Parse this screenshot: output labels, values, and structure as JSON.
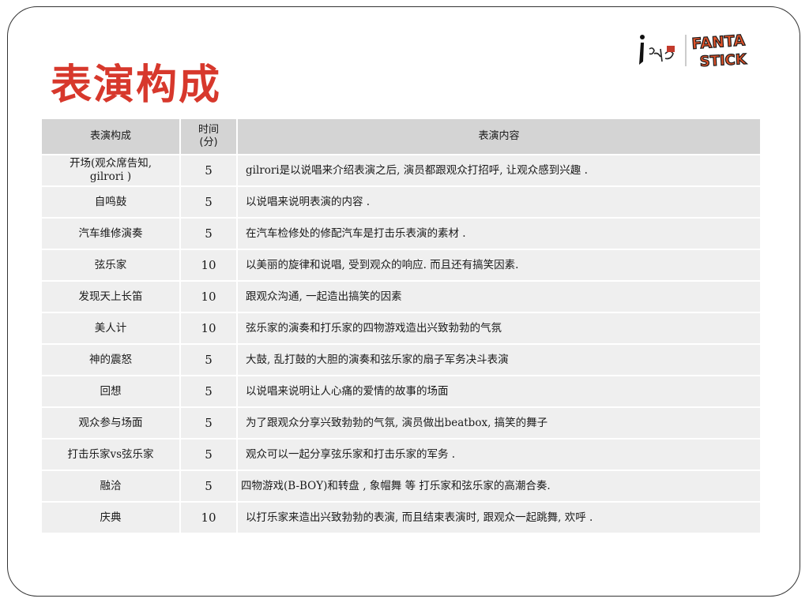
{
  "title": "表演构成",
  "logo": {
    "left_text": "i唱",
    "brand_line1": "FANTA",
    "brand_line2": "STICK",
    "brand_color": "#e0532a"
  },
  "colors": {
    "title": "#d7382c",
    "header_bg": "#d4d4d4",
    "row_bg": "#efefef"
  },
  "table": {
    "headers": {
      "name": "表演构成",
      "time_line1": "时间",
      "time_line2": "(分)",
      "desc": "表演内容"
    },
    "rows": [
      {
        "name": "开场(观众席告知,",
        "name2": "gilrori )",
        "time": "5",
        "desc": "gilrori是以说唱来介绍表演之后, 演员都跟观众打招呼, 让观众感到兴趣 ."
      },
      {
        "name": "自鸣鼓",
        "name2": "",
        "time": "5",
        "desc": "以说唱来说明表演的内容 ."
      },
      {
        "name": "汽车维修演奏",
        "name2": "",
        "time": "5",
        "desc": "在汽车检修处的修配汽车是打击乐表演的素材 ."
      },
      {
        "name": "弦乐家",
        "name2": "",
        "time": "10",
        "desc": "以美丽的旋律和说唱, 受到观众的响应. 而且还有搞笑因素."
      },
      {
        "name": "发现天上长笛",
        "name2": "",
        "time": "10",
        "desc": "跟观众沟通, 一起造出搞笑的因素"
      },
      {
        "name": "美人计",
        "name2": "",
        "time": "10",
        "desc": "弦乐家的演奏和打乐家的四物游戏造出兴致勃勃的气氛"
      },
      {
        "name": "神的震怒",
        "name2": "",
        "time": "5",
        "desc": "大鼓, 乱打鼓的大胆的演奏和弦乐家的扇子军务决斗表演"
      },
      {
        "name": "回想",
        "name2": "",
        "time": "5",
        "desc": "以说唱来说明让人心痛的爱情的故事的场面"
      },
      {
        "name": "观众参与场面",
        "name2": "",
        "time": "5",
        "desc": "为了跟观众分享兴致勃勃的气氛, 演员做出beatbox, 搞笑的舞子"
      },
      {
        "name": "打击乐家vs弦乐家",
        "name2": "",
        "time": "5",
        "desc": "观众可以一起分享弦乐家和打击乐家的军务 ."
      },
      {
        "name": "融洽",
        "name2": "",
        "time": "5",
        "desc": "四物游戏(B-BOY)和转盘 , 象帽舞 等 打乐家和弦乐家的高潮合奏."
      },
      {
        "name": "庆典",
        "name2": "",
        "time": "10",
        "desc": "以打乐家来造出兴致勃勃的表演, 而且结束表演时, 跟观众一起跳舞, 欢呼 ."
      }
    ]
  }
}
